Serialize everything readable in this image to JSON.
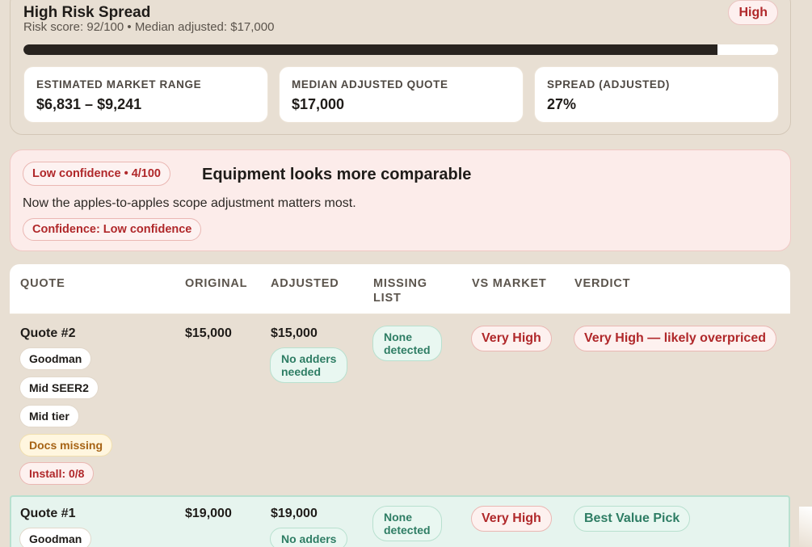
{
  "risk": {
    "title": "High Risk Spread",
    "subtitle": "Risk score: 92/100 • Median adjusted: $17,000",
    "badge": "High",
    "score_fraction": 0.92,
    "stats": [
      {
        "label": "ESTIMATED MARKET RANGE",
        "value": "$6,831 – $9,241"
      },
      {
        "label": "MEDIAN ADJUSTED QUOTE",
        "value": "$17,000"
      },
      {
        "label": "SPREAD (ADJUSTED)",
        "value": "27%"
      }
    ]
  },
  "confidence": {
    "pill": "Low confidence • 4/100",
    "title": "Equipment looks more comparable",
    "description": "Now the apples-to-apples scope adjustment matters most.",
    "tag": "Confidence: Low confidence"
  },
  "table": {
    "columns": [
      "QUOTE",
      "ORIGINAL",
      "ADJUSTED",
      "MISSING LIST",
      "VS MARKET",
      "VERDICT"
    ],
    "column_lines": {
      "missing_1": "MISSING",
      "missing_2": "LIST"
    },
    "rows": [
      {
        "name": "Quote #2",
        "tags": [
          "Goodman",
          "Mid SEER2",
          "Mid tier",
          "Docs missing",
          "Install: 0/8"
        ],
        "original": "$15,000",
        "adjusted": "$15,000",
        "adjusted_note": "No adders needed",
        "adjusted_note_lines": [
          "No adders",
          "needed"
        ],
        "missing": "None detected",
        "missing_lines": [
          "None",
          "detected"
        ],
        "vs_market": "Very High",
        "verdict": "Very High — likely overpriced"
      },
      {
        "name": "Quote #1",
        "tags": [
          "Goodman"
        ],
        "original": "$19,000",
        "adjusted": "$19,000",
        "adjusted_note_lines": [
          "No adders"
        ],
        "missing_lines": [
          "None",
          "detected"
        ],
        "vs_market": "Very High",
        "verdict": "Best Value Pick"
      }
    ]
  },
  "colors": {
    "background": "#e8dfd3",
    "danger": "#b0282a",
    "success": "#2e7d64",
    "warning": "#a66314",
    "bar_fill": "#28231f"
  }
}
